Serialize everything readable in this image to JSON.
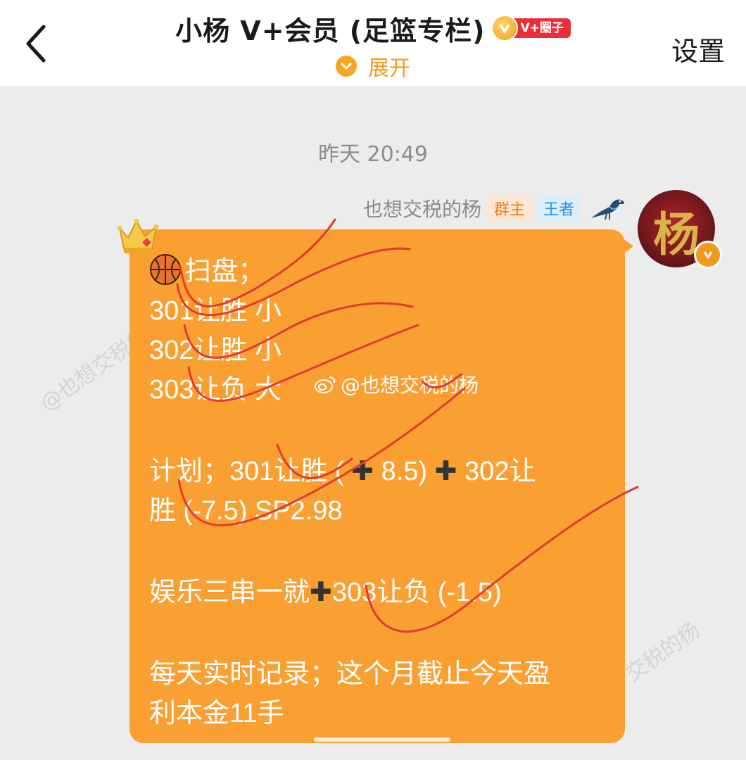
{
  "header": {
    "title": "小杨 V+会员 (足篮专栏)",
    "vip_tag": "V+圈子",
    "expand_label": "展开",
    "settings_label": "设置"
  },
  "chat": {
    "timestamp": "昨天 20:49",
    "sender": {
      "name": "也想交税的杨",
      "tags": [
        "群主",
        "王者"
      ]
    },
    "watermark": "@也想交税的杨",
    "faint_watermarks": [
      "@也想交税的杨",
      "交税的杨"
    ],
    "message": {
      "lines": [
        "扫盘；",
        "301让胜 小",
        "302让胜 小",
        "303让负 大",
        "",
        "计划；301让胜 (",
        "8.5)",
        "302让",
        "胜 (-7.5) SP2.98",
        "",
        "娱乐三串一就",
        "303让负 (-1.5)",
        "",
        "每天实时记录；这个月截止今天盈",
        "利本金11手"
      ]
    }
  },
  "colors": {
    "bubble": "#fa9f32",
    "accent": "#f39a1c",
    "vip_tag": "#ea2f38",
    "background": "#ececec"
  },
  "icons": [
    "back-chevron-icon",
    "vip-v-icon",
    "expand-chevron-icon",
    "bird-icon",
    "verified-v-icon",
    "crown-icon",
    "basketball-icon",
    "plus-icon",
    "weibo-icon"
  ]
}
